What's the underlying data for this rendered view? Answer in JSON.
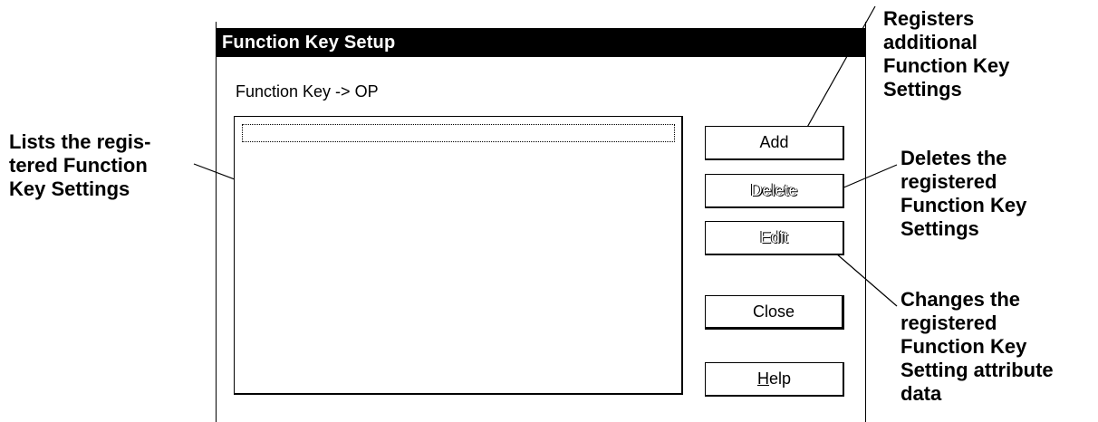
{
  "dialog": {
    "title": "Function Key Setup",
    "section_label": "Function Key -> OP",
    "buttons": {
      "add": "Add",
      "delete": "Delete",
      "edit": "Edit",
      "close": "Close",
      "help_mnemonic": "H",
      "help_rest": "elp"
    }
  },
  "callouts": {
    "list": [
      "Lists the regis-",
      "tered Function",
      "Key Settings"
    ],
    "add": [
      "Registers",
      "additional",
      "Function Key",
      "Settings"
    ],
    "delete": [
      "Deletes the",
      "registered",
      "Function Key",
      "Settings"
    ],
    "edit": [
      "Changes the",
      "registered",
      "Function Key",
      "Setting attribute",
      "data"
    ]
  }
}
